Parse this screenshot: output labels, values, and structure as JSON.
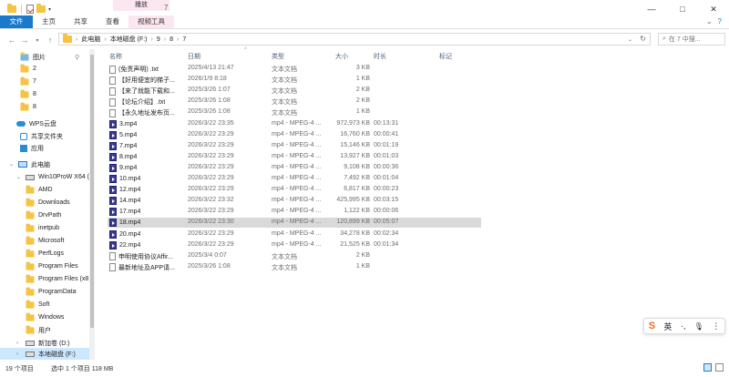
{
  "titlebar": {
    "context_tab": "播放",
    "path_title": "7",
    "minimize": "—",
    "maximize": "□",
    "close": "✕"
  },
  "ribbon": {
    "tabs": [
      "文件",
      "主页",
      "共享",
      "查看",
      "视频工具"
    ],
    "help": "?"
  },
  "address": {
    "back": "←",
    "forward": "→",
    "up_dropdown": "▾",
    "up": "↑",
    "crumbs": [
      "此电脑",
      "本地磁盘 (F:)",
      "9",
      "8",
      "7"
    ],
    "refresh": "↻",
    "search_placeholder": "在 7 中搜..."
  },
  "sidebar": {
    "items": [
      {
        "label": "图片",
        "icon": "pictures-folder-icon"
      },
      {
        "label": "2",
        "icon": "folder-icon"
      },
      {
        "label": "7",
        "icon": "folder-icon"
      },
      {
        "label": "8",
        "icon": "folder-icon"
      },
      {
        "label": "8",
        "icon": "folder-icon"
      },
      {
        "label": "WPS云盘",
        "icon": "cloud-icon"
      },
      {
        "label": "共享文件夹",
        "icon": "share-icon"
      },
      {
        "label": "应用",
        "icon": "apps-icon"
      },
      {
        "label": "此电脑",
        "icon": "pc-icon"
      },
      {
        "label": "Win10ProW X64 (C",
        "icon": "drive-icon"
      },
      {
        "label": "AMD",
        "icon": "folder-icon"
      },
      {
        "label": "Downloads",
        "icon": "folder-icon"
      },
      {
        "label": "DrvPath",
        "icon": "folder-icon"
      },
      {
        "label": "inetpub",
        "icon": "folder-icon"
      },
      {
        "label": "Microsoft",
        "icon": "folder-icon"
      },
      {
        "label": "PerfLogs",
        "icon": "folder-icon"
      },
      {
        "label": "Program Files",
        "icon": "folder-icon"
      },
      {
        "label": "Program Files (x8",
        "icon": "folder-icon"
      },
      {
        "label": "ProgramData",
        "icon": "folder-icon"
      },
      {
        "label": "Soft",
        "icon": "folder-icon"
      },
      {
        "label": "Windows",
        "icon": "folder-icon"
      },
      {
        "label": "用户",
        "icon": "folder-icon"
      },
      {
        "label": "新加卷 (D:)",
        "icon": "drive-icon"
      },
      {
        "label": "本地磁盘 (F:)",
        "icon": "drive-icon"
      }
    ]
  },
  "columns": {
    "name": "名称",
    "date": "日期",
    "type": "类型",
    "size": "大小",
    "duration": "时长",
    "tags": "标记",
    "sort_arrow": "^"
  },
  "files": [
    {
      "name": "(免责声明) .txt",
      "date": "2025/4/13 21:47",
      "type": "文本文档",
      "size": "3 KB",
      "duration": "",
      "kind": "txt"
    },
    {
      "name": "【好用便宜的梯子...",
      "date": "2026/1/9 8:18",
      "type": "文本文档",
      "size": "1 KB",
      "duration": "",
      "kind": "txt"
    },
    {
      "name": "【来了就能下载和...",
      "date": "2025/3/26 1:07",
      "type": "文本文档",
      "size": "2 KB",
      "duration": "",
      "kind": "txt"
    },
    {
      "name": "【论坛介绍】.txt",
      "date": "2025/3/26 1:08",
      "type": "文本文档",
      "size": "2 KB",
      "duration": "",
      "kind": "txt"
    },
    {
      "name": "【永久地址发布页...",
      "date": "2025/3/26 1:08",
      "type": "文本文档",
      "size": "1 KB",
      "duration": "",
      "kind": "txt"
    },
    {
      "name": "3.mp4",
      "date": "2026/3/22 23:35",
      "type": "mp4 - MPEG-4 ...",
      "size": "972,973 KB",
      "duration": "00:13:31",
      "kind": "mp4"
    },
    {
      "name": "5.mp4",
      "date": "2026/3/22 23:29",
      "type": "mp4 - MPEG-4 ...",
      "size": "16,760 KB",
      "duration": "00:00:41",
      "kind": "mp4"
    },
    {
      "name": "7.mp4",
      "date": "2026/3/22 23:29",
      "type": "mp4 - MPEG-4 ...",
      "size": "15,146 KB",
      "duration": "00:01:19",
      "kind": "mp4"
    },
    {
      "name": "8.mp4",
      "date": "2026/3/22 23:29",
      "type": "mp4 - MPEG-4 ...",
      "size": "13,927 KB",
      "duration": "00:01:03",
      "kind": "mp4"
    },
    {
      "name": "9.mp4",
      "date": "2026/3/22 23:29",
      "type": "mp4 - MPEG-4 ...",
      "size": "9,108 KB",
      "duration": "00:00:36",
      "kind": "mp4"
    },
    {
      "name": "10.mp4",
      "date": "2026/3/22 23:29",
      "type": "mp4 - MPEG-4 ...",
      "size": "7,492 KB",
      "duration": "00:01:04",
      "kind": "mp4"
    },
    {
      "name": "12.mp4",
      "date": "2026/3/22 23:29",
      "type": "mp4 - MPEG-4 ...",
      "size": "6,817 KB",
      "duration": "00:00:23",
      "kind": "mp4"
    },
    {
      "name": "14.mp4",
      "date": "2026/3/22 23:32",
      "type": "mp4 - MPEG-4 ...",
      "size": "425,995 KB",
      "duration": "00:03:15",
      "kind": "mp4"
    },
    {
      "name": "17.mp4",
      "date": "2026/3/22 23:29",
      "type": "mp4 - MPEG-4 ...",
      "size": "1,122 KB",
      "duration": "00:00:06",
      "kind": "mp4"
    },
    {
      "name": "18.mp4",
      "date": "2026/3/22 23:30",
      "type": "mp4 - MPEG-4 ...",
      "size": "120,899 KB",
      "duration": "00:05:07",
      "kind": "mp4",
      "selected": true
    },
    {
      "name": "20.mp4",
      "date": "2026/3/22 23:29",
      "type": "mp4 - MPEG-4 ...",
      "size": "34,278 KB",
      "duration": "00:02:34",
      "kind": "mp4"
    },
    {
      "name": "22.mp4",
      "date": "2026/3/22 23:29",
      "type": "mp4 - MPEG-4 ...",
      "size": "21,525 KB",
      "duration": "00:01:34",
      "kind": "mp4"
    },
    {
      "name": "申明使用协议Affir...",
      "date": "2025/3/4 0:07",
      "type": "文本文档",
      "size": "2 KB",
      "duration": "",
      "kind": "txt"
    },
    {
      "name": "最新地址及APP请...",
      "date": "2025/3/26 1:08",
      "type": "文本文档",
      "size": "1 KB",
      "duration": "",
      "kind": "txt"
    }
  ],
  "ime": {
    "logo": "S",
    "lang": "英",
    "punct": "·,",
    "mic": "🎙",
    "more": "⋮"
  },
  "status": {
    "count": "19 个项目",
    "selected": "选中 1 个项目  118 MB"
  }
}
